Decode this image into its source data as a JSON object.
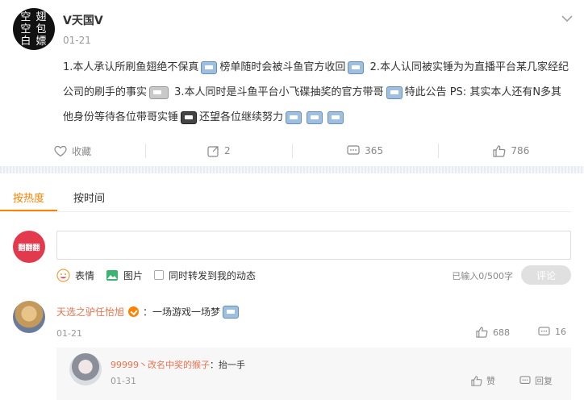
{
  "post": {
    "avatar_text": [
      "空 翅",
      "空 包",
      "白 嫖"
    ],
    "author": "V天国V",
    "date": "01-21",
    "content_segments": [
      "1.本人承认所刷鱼翅绝不保真",
      "榜单随时会被斗鱼官方收回",
      "2.本人认同被实锤为为直播平台某几家经纪公司的刷手的事实",
      "3.本人同时是斗鱼平台小飞碟抽奖的官方带哥",
      "特此公告",
      "PS: 其实本人还有N多其他身份等待各位带哥实锤",
      "还望各位继续努力"
    ],
    "actions": {
      "collect_label": "收藏",
      "repost_count": "2",
      "comment_count": "365",
      "like_count": "786"
    }
  },
  "tabs": [
    {
      "label": "按热度",
      "active": true
    },
    {
      "label": "按时间",
      "active": false
    }
  ],
  "composer": {
    "avatar_text": "翻翻翻",
    "emoji_label": "表情",
    "image_label": "图片",
    "repost_label": "同时转发到我的动态",
    "counter": "已输入0/500字",
    "submit_label": "评论"
  },
  "comments": [
    {
      "name": "天选之驴任怡旭",
      "text": "：一场游戏一场梦",
      "date": "01-21",
      "likes": "688",
      "replies": "16",
      "reply": {
        "name": "99999丶改名中奖的猴子",
        "text": "：抬一手",
        "date": "01-31",
        "like_label": "赞",
        "reply_label": "回复"
      }
    }
  ],
  "colors": {
    "accent": "#ff8200",
    "name": "#eb7350"
  },
  "icons": [
    "more-icon",
    "star-icon",
    "repost-icon",
    "comment-icon",
    "like-icon",
    "emoji-icon",
    "image-icon",
    "verified-badge-icon"
  ]
}
